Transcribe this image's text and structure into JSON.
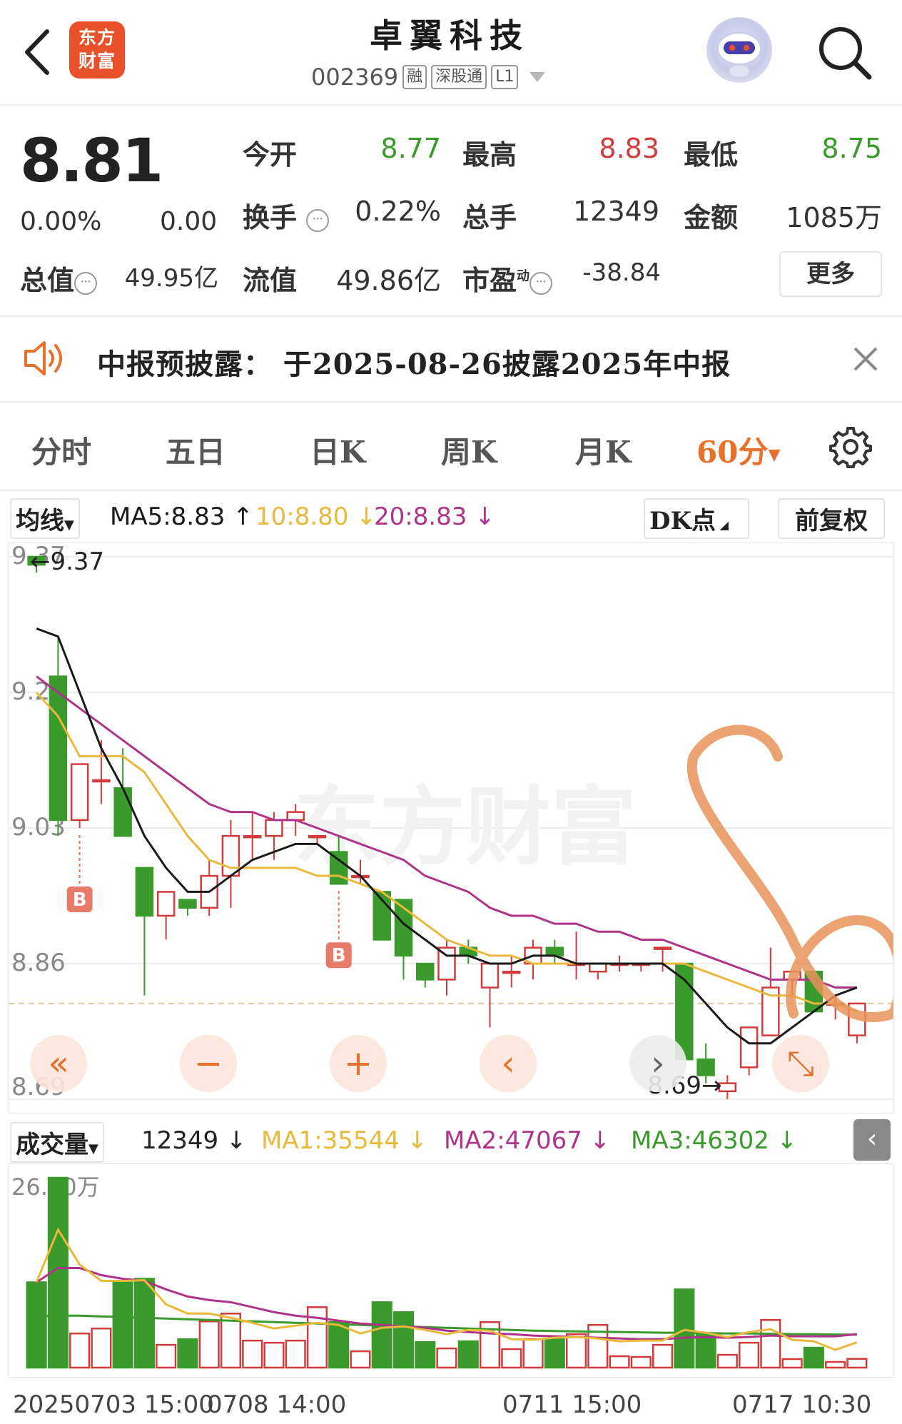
{
  "header": {
    "title": "卓翼科技",
    "logo_text_1": "东方",
    "logo_text_2": "财富",
    "code": "002369",
    "tags": [
      "融",
      "深股通",
      "L1"
    ]
  },
  "quote": {
    "price": "8.81",
    "change_pct": "0.00%",
    "change": "0.00",
    "open_label": "今开",
    "open": "8.77",
    "high_label": "最高",
    "high": "8.83",
    "low_label": "最低",
    "low": "8.75",
    "turnover_label": "换手",
    "turnover": "0.22%",
    "volume_label": "总手",
    "volume": "12349",
    "amount_label": "金额",
    "amount": "1085万",
    "mktcap_label": "总值",
    "mktcap": "49.95亿",
    "float_label": "流值",
    "float": "49.86亿",
    "pe_label": "市盈",
    "pe_sup": "动",
    "pe": "-38.84",
    "more_label": "更多"
  },
  "notice": {
    "text": "中报预披露： 于2025-08-26披露2025年中报"
  },
  "tabs": [
    "分时",
    "五日",
    "日K",
    "周K",
    "月K",
    "60分"
  ],
  "active_tab": "60分",
  "ma": {
    "selector": "均线",
    "ma5": "MA5:8.83",
    "ma10": "10:8.80",
    "ma20": "20:8.83",
    "dk": "DK点",
    "adjust": "前复权"
  },
  "chart_labels": {
    "high_marker": "←9.37",
    "low_marker": "8.69→",
    "watermark": "东方财富",
    "buy_mark": "B"
  },
  "volume": {
    "selector": "成交量",
    "value": "12349",
    "ma1": "MA1:35544",
    "ma2": "MA2:47067",
    "ma3": "MA3:46302",
    "top_label": "26.70万"
  },
  "colors": {
    "up": "#d13b3b",
    "down": "#3a9a2c",
    "ma5": "#1a1a1a",
    "ma10": "#e8b93a",
    "ma20": "#b0338a",
    "vol_ma3": "#3a9a2c",
    "accent": "#e8702a"
  },
  "chart_data": {
    "type": "candlestick",
    "yticks": [
      "9.37",
      "9.20",
      "9.03",
      "8.86",
      "8.69"
    ],
    "ylim": [
      8.69,
      9.37
    ],
    "ohlc": [
      {
        "o": 9.37,
        "h": 9.37,
        "l": 9.35,
        "c": 9.36
      },
      {
        "o": 9.22,
        "h": 9.27,
        "l": 9.02,
        "c": 9.04
      },
      {
        "o": 9.04,
        "h": 9.11,
        "l": 9.03,
        "c": 9.11
      },
      {
        "o": 9.09,
        "h": 9.14,
        "l": 9.06,
        "c": 9.09
      },
      {
        "o": 9.08,
        "h": 9.13,
        "l": 9.02,
        "c": 9.02
      },
      {
        "o": 8.98,
        "h": 8.98,
        "l": 8.82,
        "c": 8.92
      },
      {
        "o": 8.92,
        "h": 8.95,
        "l": 8.89,
        "c": 8.95
      },
      {
        "o": 8.94,
        "h": 8.94,
        "l": 8.92,
        "c": 8.93
      },
      {
        "o": 8.93,
        "h": 8.99,
        "l": 8.92,
        "c": 8.97
      },
      {
        "o": 8.97,
        "h": 9.04,
        "l": 8.93,
        "c": 9.02
      },
      {
        "o": 9.02,
        "h": 9.05,
        "l": 8.99,
        "c": 9.02
      },
      {
        "o": 9.02,
        "h": 9.05,
        "l": 8.99,
        "c": 9.04
      },
      {
        "o": 9.04,
        "h": 9.06,
        "l": 9.02,
        "c": 9.05
      },
      {
        "o": 9.02,
        "h": 9.02,
        "l": 9.01,
        "c": 9.02
      },
      {
        "o": 9.0,
        "h": 9.02,
        "l": 8.96,
        "c": 8.96
      },
      {
        "o": 8.97,
        "h": 8.99,
        "l": 8.96,
        "c": 8.97
      },
      {
        "o": 8.95,
        "h": 8.95,
        "l": 8.89,
        "c": 8.89
      },
      {
        "o": 8.94,
        "h": 8.94,
        "l": 8.84,
        "c": 8.87
      },
      {
        "o": 8.86,
        "h": 8.86,
        "l": 8.83,
        "c": 8.84
      },
      {
        "o": 8.84,
        "h": 8.89,
        "l": 8.82,
        "c": 8.88
      },
      {
        "o": 8.88,
        "h": 8.89,
        "l": 8.86,
        "c": 8.87
      },
      {
        "o": 8.83,
        "h": 8.86,
        "l": 8.78,
        "c": 8.86
      },
      {
        "o": 8.85,
        "h": 8.87,
        "l": 8.83,
        "c": 8.85
      },
      {
        "o": 8.86,
        "h": 8.89,
        "l": 8.84,
        "c": 8.88
      },
      {
        "o": 8.88,
        "h": 8.89,
        "l": 8.86,
        "c": 8.87
      },
      {
        "o": 8.86,
        "h": 8.9,
        "l": 8.84,
        "c": 8.86
      },
      {
        "o": 8.85,
        "h": 8.86,
        "l": 8.84,
        "c": 8.86
      },
      {
        "o": 8.86,
        "h": 8.87,
        "l": 8.85,
        "c": 8.86
      },
      {
        "o": 8.86,
        "h": 8.86,
        "l": 8.85,
        "c": 8.86
      },
      {
        "o": 8.88,
        "h": 8.88,
        "l": 8.85,
        "c": 8.88
      },
      {
        "o": 8.86,
        "h": 8.86,
        "l": 8.74,
        "c": 8.74
      },
      {
        "o": 8.74,
        "h": 8.76,
        "l": 8.71,
        "c": 8.72
      },
      {
        "o": 8.7,
        "h": 8.72,
        "l": 8.69,
        "c": 8.71
      },
      {
        "o": 8.73,
        "h": 8.78,
        "l": 8.72,
        "c": 8.78
      },
      {
        "o": 8.77,
        "h": 8.88,
        "l": 8.77,
        "c": 8.83
      },
      {
        "o": 8.84,
        "h": 8.85,
        "l": 8.82,
        "c": 8.85
      },
      {
        "o": 8.85,
        "h": 8.85,
        "l": 8.8,
        "c": 8.8
      },
      {
        "o": 8.81,
        "h": 8.82,
        "l": 8.79,
        "c": 8.81
      },
      {
        "o": 8.77,
        "h": 8.81,
        "l": 8.76,
        "c": 8.81
      }
    ],
    "ma5": [
      9.28,
      9.27,
      9.2,
      9.13,
      9.08,
      9.02,
      8.98,
      8.95,
      8.95,
      8.97,
      8.99,
      9.0,
      9.01,
      9.01,
      8.99,
      8.97,
      8.94,
      8.91,
      8.89,
      8.87,
      8.87,
      8.86,
      8.86,
      8.87,
      8.87,
      8.86,
      8.86,
      8.86,
      8.86,
      8.86,
      8.84,
      8.81,
      8.78,
      8.76,
      8.76,
      8.78,
      8.8,
      8.82,
      8.83
    ],
    "ma10": [
      9.2,
      9.17,
      9.12,
      9.12,
      9.12,
      9.1,
      9.06,
      9.02,
      8.99,
      8.98,
      8.98,
      8.98,
      8.98,
      8.97,
      8.97,
      8.96,
      8.95,
      8.93,
      8.91,
      8.89,
      8.88,
      8.87,
      8.87,
      8.86,
      8.86,
      8.86,
      8.86,
      8.86,
      8.86,
      8.86,
      8.86,
      8.85,
      8.84,
      8.83,
      8.82,
      8.82,
      8.81,
      8.81,
      8.8
    ],
    "ma20": [
      9.22,
      9.2,
      9.18,
      9.16,
      9.14,
      9.12,
      9.1,
      9.08,
      9.06,
      9.05,
      9.05,
      9.04,
      9.04,
      9.03,
      9.02,
      9.01,
      9.0,
      8.99,
      8.97,
      8.96,
      8.95,
      8.93,
      8.92,
      8.92,
      8.91,
      8.91,
      8.9,
      8.9,
      8.89,
      8.89,
      8.88,
      8.87,
      8.86,
      8.85,
      8.84,
      8.84,
      8.84,
      8.83,
      8.83
    ],
    "buy_signals": [
      2,
      14
    ],
    "volumes": [
      120000,
      267000,
      48000,
      55000,
      120000,
      125000,
      32000,
      40000,
      65000,
      76000,
      38000,
      35000,
      38000,
      85000,
      64000,
      23000,
      92000,
      78000,
      36000,
      27000,
      37000,
      64000,
      26000,
      40000,
      40000,
      47000,
      60000,
      16000,
      15000,
      32000,
      110000,
      48000,
      18000,
      35000,
      67000,
      12000,
      28000,
      8000,
      12349
    ],
    "vol_ma1": [
      120000,
      194000,
      145000,
      122000,
      122000,
      123000,
      89000,
      76000,
      76000,
      70000,
      63000,
      55000,
      59000,
      63000,
      60000,
      48000,
      56000,
      58000,
      53000,
      47000,
      53000,
      52000,
      40000,
      39000,
      42000,
      43000,
      41000,
      37000,
      38000,
      38000,
      53000,
      49000,
      43000,
      50000,
      54000,
      39000,
      37000,
      25000,
      35544
    ],
    "vol_ma2": [
      120000,
      140000,
      140000,
      130000,
      125000,
      122000,
      110000,
      100000,
      95000,
      92000,
      85000,
      78000,
      73000,
      70000,
      66000,
      62000,
      60000,
      58000,
      56000,
      52000,
      50000,
      48000,
      47000,
      45000,
      44000,
      43000,
      42000,
      41000,
      40000,
      40000,
      42000,
      43000,
      42000,
      43000,
      45000,
      44000,
      44000,
      44000,
      47067
    ],
    "vol_ma3": [
      72000,
      73000,
      73000,
      72000,
      71000,
      70000,
      69000,
      68000,
      67000,
      66000,
      65000,
      64000,
      63000,
      62000,
      61000,
      60000,
      59000,
      58000,
      57000,
      56000,
      55000,
      54000,
      53000,
      52000,
      51500,
      51000,
      50500,
      50000,
      49500,
      49000,
      49000,
      48500,
      48000,
      48000,
      47500,
      47000,
      47000,
      46500,
      46302
    ],
    "vol_ylim": [
      0,
      267000
    ],
    "x_labels": [
      "20250703 15:00",
      "0708 14:00",
      "0711 15:00",
      "0717 10:30"
    ]
  }
}
